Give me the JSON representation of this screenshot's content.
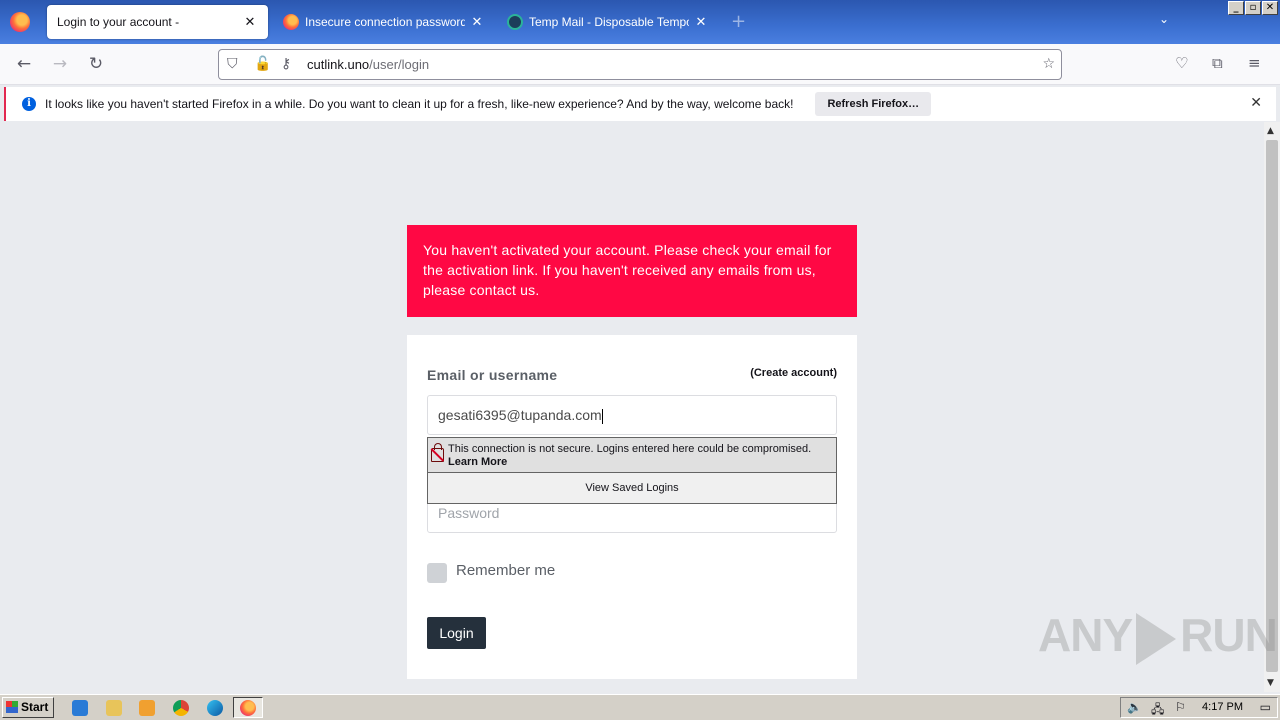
{
  "browser": {
    "tabs": [
      {
        "title": "Login to your account -",
        "active": true
      },
      {
        "title": "Insecure connection password war",
        "active": false
      },
      {
        "title": "Temp Mail - Disposable Temporary E",
        "active": false
      }
    ],
    "url_host": "cutlink.uno",
    "url_path": "/user/login",
    "notification": {
      "message": "It looks like you haven't started Firefox in a while. Do you want to clean it up for a fresh, like-new experience? And by the way, welcome back!",
      "button": "Refresh Firefox…"
    }
  },
  "page": {
    "alert": "You haven't activated your account. Please check your email for the activation link. If you haven't received any emails from us, please contact us.",
    "email_label": "Email or username",
    "create_account": "(Create account)",
    "email_value": "gesati6395@tupanda.com",
    "password_placeholder": "Password",
    "remember_label": "Remember me",
    "login_button": "Login"
  },
  "autocomplete": {
    "warning": "This connection is not secure. Logins entered here could be compromised.",
    "learn_more": "Learn More",
    "view_saved": "View Saved Logins"
  },
  "watermark": {
    "left": "ANY",
    "right": "RUN"
  },
  "taskbar": {
    "start_label": "Start",
    "clock": "4:17 PM"
  }
}
